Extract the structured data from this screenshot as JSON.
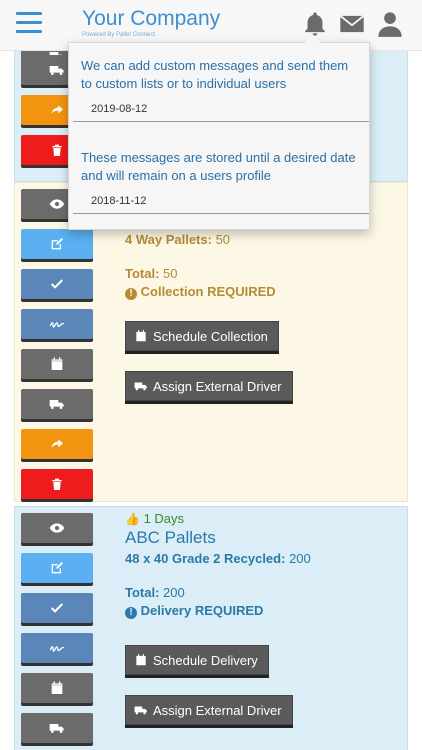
{
  "header": {
    "title": "Your Company",
    "subtitle": "Powered By Pallet Connect"
  },
  "notifications": [
    {
      "text": "We can add custom messages and send them to custom lists or to individual users",
      "date": "2019-08-12"
    },
    {
      "text": "These messages are stored until a desired date and will remain on a users profile",
      "date": "2018-11-12"
    }
  ],
  "order1": {
    "pallet_line_label": "4 Way Pallets:",
    "pallet_line_value": "50",
    "total_label": "Total:",
    "total_value": "50",
    "status": "Collection REQUIRED",
    "schedule_button": "Schedule Collection",
    "assign_button": "Assign External Driver"
  },
  "order2": {
    "days": "1 Days",
    "name": "ABC Pallets",
    "pallet_line_label": "48 x 40 Grade 2 Recycled:",
    "pallet_line_value": "200",
    "total_label": "Total:",
    "total_value": "200",
    "status": "Delivery REQUIRED",
    "schedule_button": "Schedule Delivery",
    "assign_button": "Assign External Driver"
  },
  "colors": {
    "brand_blue": "#3b8fd3",
    "gold": "#b68b36",
    "info_blue": "#2a7aa8",
    "orange": "#f39410",
    "red": "#ee1c1c"
  }
}
